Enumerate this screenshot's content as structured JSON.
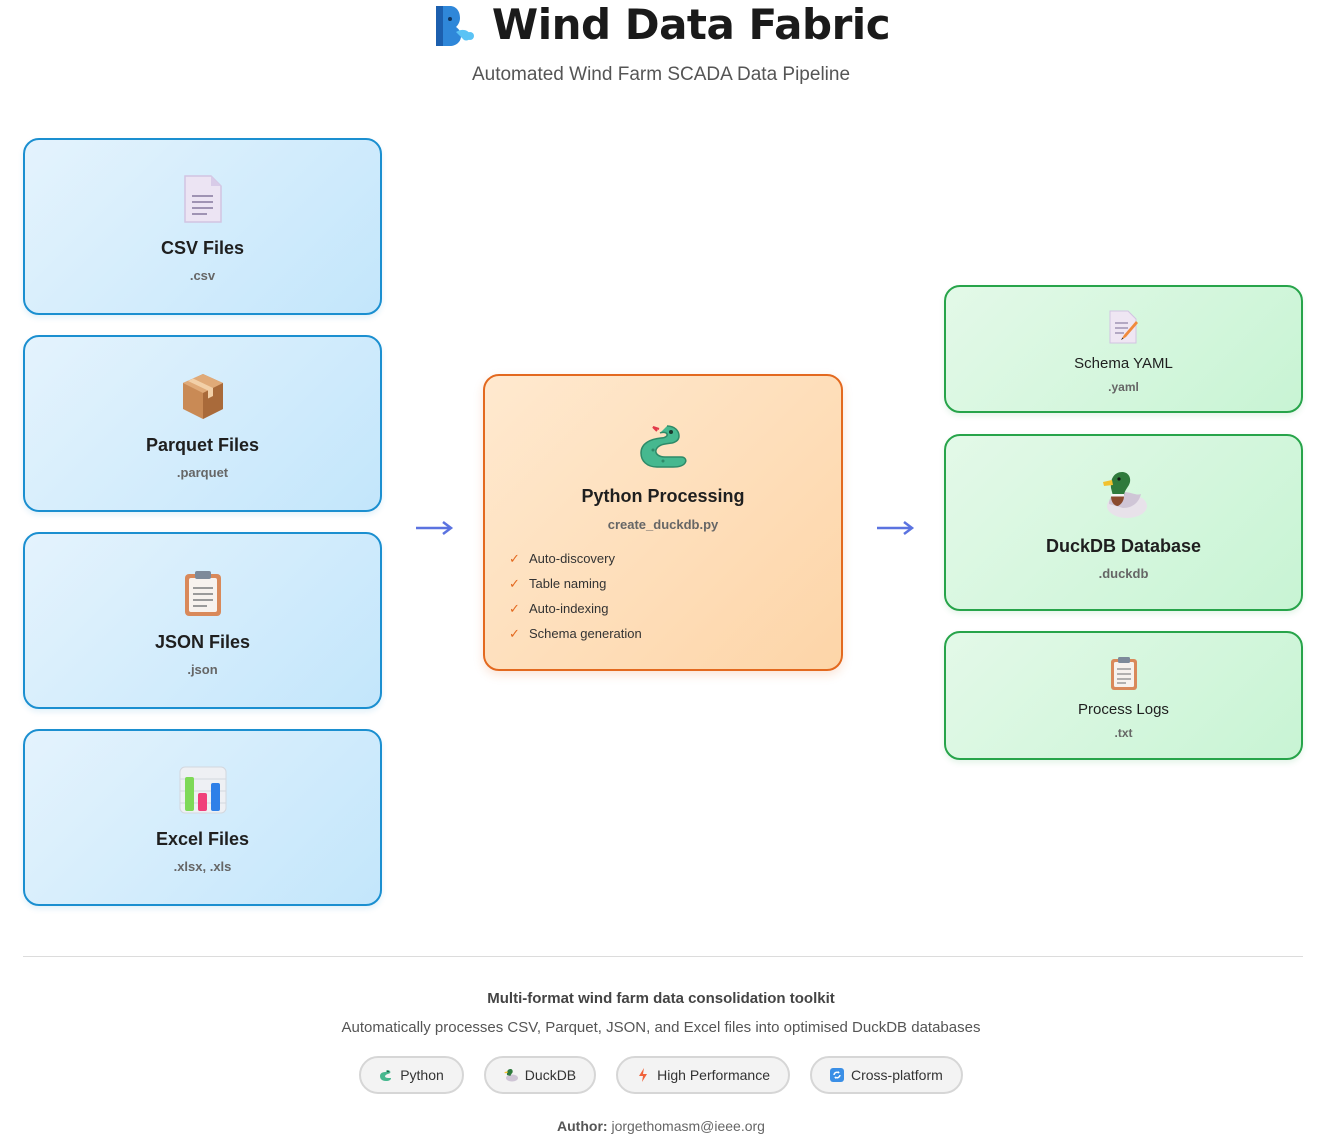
{
  "header": {
    "logo_icon": "wind-face-icon",
    "title": "Wind Data Fabric",
    "subtitle": "Automated Wind Farm SCADA Data Pipeline"
  },
  "inputs": [
    {
      "icon": "document-icon",
      "name": "CSV Files",
      "ext": ".csv"
    },
    {
      "icon": "package-icon",
      "name": "Parquet Files",
      "ext": ".parquet"
    },
    {
      "icon": "clipboard-icon",
      "name": "JSON Files",
      "ext": ".json"
    },
    {
      "icon": "bar-chart-icon",
      "name": "Excel Files",
      "ext": ".xlsx, .xls"
    }
  ],
  "processor": {
    "icon": "snake-icon",
    "name": "Python Processing",
    "script": "create_duckdb.py",
    "features": [
      "Auto-discovery",
      "Table naming",
      "Auto-indexing",
      "Schema generation"
    ]
  },
  "outputs": [
    {
      "icon": "memo-icon",
      "name": "Schema YAML",
      "ext": ".yaml"
    },
    {
      "icon": "duck-icon",
      "name": "DuckDB Database",
      "ext": ".duckdb"
    },
    {
      "icon": "clipboard-icon",
      "name": "Process Logs",
      "ext": ".txt"
    }
  ],
  "footer": {
    "tagline": "Multi-format wind farm data consolidation toolkit",
    "description": "Automatically processes CSV, Parquet, JSON, and Excel files into optimised DuckDB databases",
    "badges": [
      {
        "icon": "snake-icon",
        "label": "Python"
      },
      {
        "icon": "duck-icon",
        "label": "DuckDB"
      },
      {
        "icon": "lightning-icon",
        "label": "High Performance"
      },
      {
        "icon": "refresh-icon",
        "label": "Cross-platform"
      }
    ],
    "author_label": "Author:",
    "author_email": "jorgethomasm@ieee.org"
  },
  "colors": {
    "input_border": "#1b8fd0",
    "process_border": "#e3691f",
    "output_border": "#27a44a",
    "arrow": "#5b73e0"
  }
}
